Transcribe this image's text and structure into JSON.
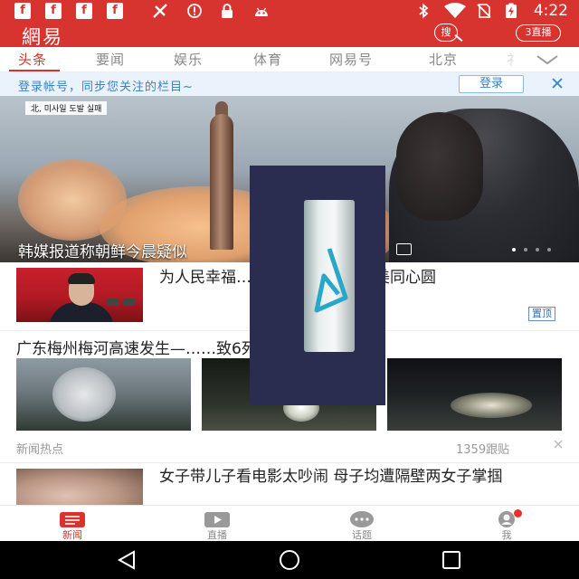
{
  "status_bar": {
    "time": "4:22",
    "left_icons": [
      "facebook-icon",
      "facebook-icon",
      "facebook-icon",
      "facebook-icon",
      "signal-off-icon",
      "alert-icon",
      "lock-icon",
      "android-icon"
    ],
    "right_icons": [
      "bluetooth-icon",
      "wifi-icon",
      "no-sim-icon",
      "battery-charging-icon"
    ]
  },
  "app_bar": {
    "logo": "網易",
    "search_label": "搜",
    "live_label": "3直播"
  },
  "channels": {
    "items": [
      "头条",
      "要闻",
      "娱乐",
      "体育",
      "网易号",
      "北京",
      "礻"
    ],
    "active_index": 0
  },
  "login_banner": {
    "text": "登录帐号，同步您关注的栏目~",
    "button": "登录"
  },
  "hero": {
    "tag": "北, 미사일 도발 실패",
    "title": "韩媒报道称朝鲜今晨疑似",
    "slide_count": 4,
    "current_slide": 0
  },
  "feed": {
    "article1": {
      "title": "为人民幸福……，习近平画出最美同心圆",
      "badge": "置顶"
    },
    "article2": {
      "title": "广东梅州梅河高速发生—……致6死3伤",
      "source": "新闻热点",
      "comments": "1359跟贴"
    },
    "article3": {
      "title": "女子带儿子看电影太吵闹 母子均遭隔壁两女子掌掴"
    }
  },
  "bottom_nav": {
    "items": [
      {
        "label": "新闻",
        "icon": "news-icon"
      },
      {
        "label": "直播",
        "icon": "live-play-icon"
      },
      {
        "label": "话题",
        "icon": "chat-bubble-icon"
      },
      {
        "label": "我",
        "icon": "profile-icon"
      }
    ],
    "active_index": 0
  },
  "colors": {
    "brand": "#d7332f",
    "banner_text": "#3a82c4",
    "overlay": "#2a2c50",
    "overlay_glyph": "#2aa6c8"
  }
}
